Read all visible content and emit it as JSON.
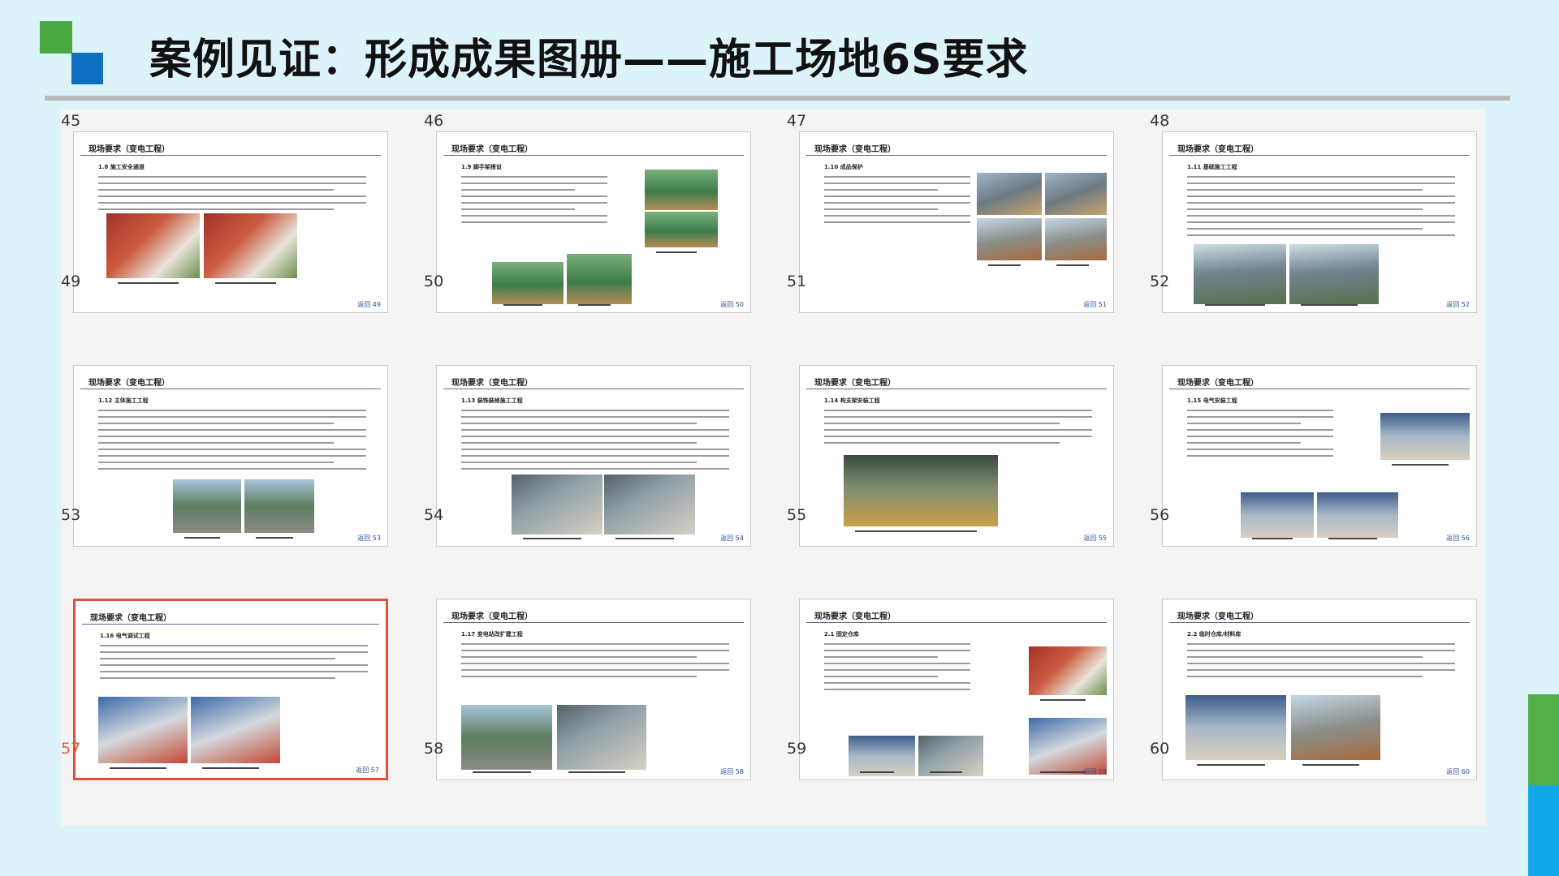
{
  "header": {
    "title": "案例见证：形成成果图册——施工场地6S要求"
  },
  "gallery": {
    "top_numbers": [
      "45",
      "46",
      "47",
      "48"
    ],
    "cells": [
      {
        "num": "49",
        "head": "现场要求（变电工程）",
        "section": "1.8  施工安全通道",
        "foot": "返回  49",
        "selected": false
      },
      {
        "num": "50",
        "head": "现场要求（变电工程）",
        "section": "1.9  脚手架搭设",
        "foot": "返回  50",
        "selected": false
      },
      {
        "num": "51",
        "head": "现场要求（变电工程）",
        "section": "1.10  成品保护",
        "foot": "返回  51",
        "selected": false
      },
      {
        "num": "52",
        "head": "现场要求（变电工程）",
        "section": "1.11  基础施工工程",
        "foot": "返回  52",
        "selected": false
      },
      {
        "num": "53",
        "head": "现场要求（变电工程）",
        "section": "1.12  主体施工工程",
        "foot": "返回  53",
        "selected": false
      },
      {
        "num": "54",
        "head": "现场要求（变电工程）",
        "section": "1.13  装饰装修施工工程",
        "foot": "返回  54",
        "selected": false
      },
      {
        "num": "55",
        "head": "现场要求（变电工程）",
        "section": "1.14  构支架安装工程",
        "foot": "返回  55",
        "selected": false
      },
      {
        "num": "56",
        "head": "现场要求（变电工程）",
        "section": "1.15  电气安装工程",
        "foot": "返回  56",
        "selected": false
      },
      {
        "num": "57",
        "head": "现场要求（变电工程）",
        "section": "1.16  电气调试工程",
        "foot": "返回  57",
        "selected": true
      },
      {
        "num": "58",
        "head": "现场要求（变电工程）",
        "section": "1.17  变电站改扩建工程",
        "foot": "返回  58",
        "selected": false
      },
      {
        "num": "59",
        "head": "现场要求（变电工程）",
        "section": "2.1  固定仓库",
        "foot": "返回  59",
        "selected": false
      },
      {
        "num": "60",
        "head": "现场要求（变电工程）",
        "section": "2.2  临时仓库/材料库",
        "foot": "返回  60",
        "selected": false
      }
    ]
  },
  "colors": {
    "background": "#ddf3fa",
    "accent_green": "#49a942",
    "accent_blue": "#0e6fc1",
    "selection": "#e05236"
  }
}
